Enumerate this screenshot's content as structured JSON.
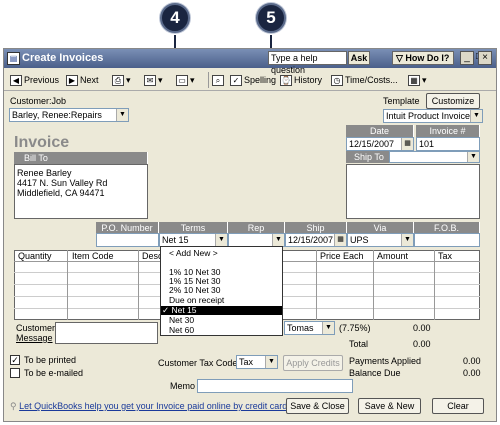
{
  "callouts": {
    "step4": "4",
    "step5": "5"
  },
  "window": {
    "title": "Create Invoices",
    "help_placeholder": "Type a help question",
    "ask_label": "Ask",
    "howdo_label": "How Do I?",
    "minimize": "_",
    "restore": "□",
    "close": "×"
  },
  "toolbar": {
    "previous": "Previous",
    "next": "Next",
    "spelling": "Spelling",
    "history": "History",
    "time_costs": "Time/Costs..."
  },
  "customer": {
    "label": "Customer:Job",
    "value": "Barley, Renee:Repairs"
  },
  "template": {
    "label": "Template",
    "customize_label": "Customize",
    "value": "Intuit Product Invoice"
  },
  "invoice": {
    "title": "Invoice",
    "date_label": "Date",
    "date_value": "12/15/2007",
    "number_label": "Invoice #",
    "number_value": "101",
    "bill_to_label": "Bill To",
    "bill_to_lines": [
      "Renee Barley",
      "4417 N. Sun Valley Rd",
      "Middlefield, CA  94471"
    ],
    "ship_to_label": "Ship To"
  },
  "order_fields": {
    "po_label": "P.O. Number",
    "terms_label": "Terms",
    "terms_value": "Net 15",
    "rep_label": "Rep",
    "ship_label": "Ship",
    "ship_value": "12/15/2007",
    "via_label": "Via",
    "via_value": "UPS",
    "fob_label": "F.O.B."
  },
  "line_items": {
    "columns": [
      "Quantity",
      "Item Code",
      "Desc",
      "Price Each",
      "Amount",
      "Tax"
    ]
  },
  "terms_dropdown": {
    "items": [
      "< Add New >",
      "1% 10 Net 30",
      "1% 15 Net 30",
      "2% 10 Net 30",
      "Due on receipt",
      "Net 15",
      "Net 30",
      "Net 60"
    ],
    "selected": "✓ Net 15"
  },
  "footer": {
    "customer_message_label_1": "Customer",
    "customer_message_label_2": "Message",
    "tax_item_value": "Tomas",
    "tax_rate": "(7.75%)",
    "tax_amount": "0.00",
    "total_label": "Total",
    "total_value": "0.00",
    "to_be_printed": "To be printed",
    "to_be_emailed": "To be e-mailed",
    "customer_tax_code_label": "Customer Tax Code",
    "tax_code_value": "Tax",
    "apply_credits": "Apply Credits",
    "payments_applied_label": "Payments Applied",
    "payments_applied_value": "0.00",
    "balance_due_label": "Balance Due",
    "balance_due_value": "0.00",
    "memo_label": "Memo",
    "quickbooks_link": "Let QuickBooks help you get your Invoice paid online by credit card.",
    "save_close": "Save & Close",
    "save_new": "Save & New",
    "clear": "Clear"
  }
}
